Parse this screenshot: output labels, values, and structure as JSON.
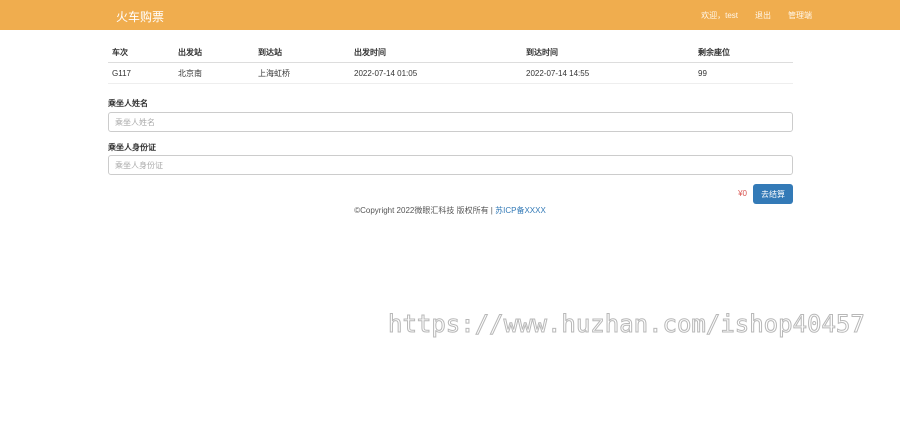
{
  "navbar": {
    "brand": "火车购票",
    "links": [
      "欢迎，test",
      "退出",
      "管理端"
    ]
  },
  "table": {
    "headers": [
      "车次",
      "出发站",
      "到达站",
      "出发时间",
      "到达时间",
      "剩余座位"
    ],
    "rows": [
      [
        "G117",
        "北京南",
        "上海虹桥",
        "2022-07-14 01:05",
        "2022-07-14 14:55",
        "99"
      ]
    ]
  },
  "form": {
    "name_label": "乘坐人姓名",
    "name_placeholder": "乘坐人姓名",
    "id_label": "乘坐人身份证",
    "id_placeholder": "乘坐人身份证"
  },
  "checkout": {
    "price": "¥0",
    "button_label": "去结算"
  },
  "footer": {
    "copyright": "©Copyright 2022微眼汇科技 版权所有 | ",
    "icp_link": "苏ICP备XXXX"
  },
  "watermark": "https://www.huzhan.com/ishop40457",
  "colors": {
    "navbar": "#f0ad4e",
    "button": "#337ab7",
    "price": "#d9534f"
  }
}
